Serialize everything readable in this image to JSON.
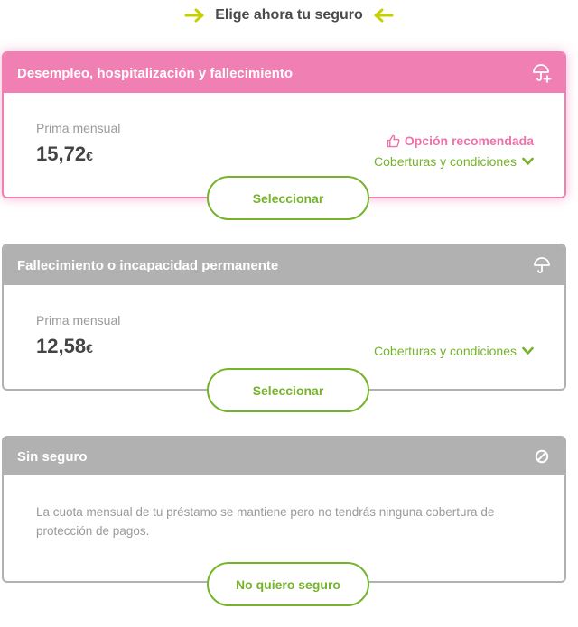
{
  "heading": {
    "text": "Elige ahora tu seguro"
  },
  "options": [
    {
      "title": "Desempleo, hospitalización y fallecimiento",
      "icon": "umbrella-plus-icon",
      "premium_label": "Prima mensual",
      "premium_value": "15,72",
      "currency": "€",
      "recommended": "Opción recomendada",
      "coverage_link": "Coberturas y condiciones",
      "button": "Seleccionar"
    },
    {
      "title": "Fallecimiento o incapacidad permanente",
      "icon": "umbrella-icon",
      "premium_label": "Prima mensual",
      "premium_value": "12,58",
      "currency": "€",
      "coverage_link": "Coberturas y condiciones",
      "button": "Seleccionar"
    },
    {
      "title": "Sin seguro",
      "icon": "no-entry-icon",
      "note": "La cuota mensual de tu préstamo se mantiene pero no tendrás ninguna cobertura de protección de pagos.",
      "button": "No quiero seguro"
    }
  ],
  "colors": {
    "accent_green": "#74b32a",
    "recommended_pink": "#f080b3",
    "header_gray": "#b1b1b1",
    "arrow_yellow": "#c6cf00"
  }
}
